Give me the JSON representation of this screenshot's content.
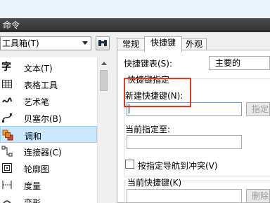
{
  "window": {
    "title": "命令"
  },
  "toolbox": {
    "selected": "工具箱(T)"
  },
  "commands": [
    {
      "label": "文本(T)",
      "icon": "text-char-icon",
      "glyph": "字"
    },
    {
      "label": "表格工具",
      "icon": "table-icon",
      "glyph": ""
    },
    {
      "label": "艺术笔",
      "icon": "artistic-pen-icon",
      "glyph": "∿"
    },
    {
      "label": "贝塞尔(B)",
      "icon": "bezier-icon",
      "glyph": ""
    },
    {
      "label": "调和",
      "icon": "blend-icon",
      "glyph": "",
      "selected": true
    },
    {
      "label": "连接器(C)",
      "icon": "connector-icon",
      "glyph": ""
    },
    {
      "label": "轮廓图",
      "icon": "contour-icon",
      "glyph": ""
    },
    {
      "label": "度量",
      "icon": "dimension-icon",
      "glyph": ""
    },
    {
      "label": "变形",
      "icon": "distort-icon",
      "glyph": ""
    }
  ],
  "tabs": [
    {
      "label": "常规",
      "active": false
    },
    {
      "label": "快捷键",
      "active": true
    },
    {
      "label": "外观",
      "active": false
    }
  ],
  "shortcuts": {
    "table_label": "快捷键表(S):",
    "table_value": "主要的",
    "group_title": "快捷键指定",
    "new_key_label": "新建快捷键(N):",
    "new_key_value": "",
    "assign_button": "指定",
    "current_assigned_label": "当前指定至:",
    "current_assigned_value": "",
    "navigate_conflict_label": "按指定导航到冲突(V)",
    "navigate_conflict_checked": false,
    "current_shortcuts_label": "当前快捷键(K)",
    "delete_button": "删除"
  },
  "colors": {
    "titlebar": "#3a3a3a",
    "selection": "#cce8ff",
    "highlight_box": "#e8391c"
  }
}
